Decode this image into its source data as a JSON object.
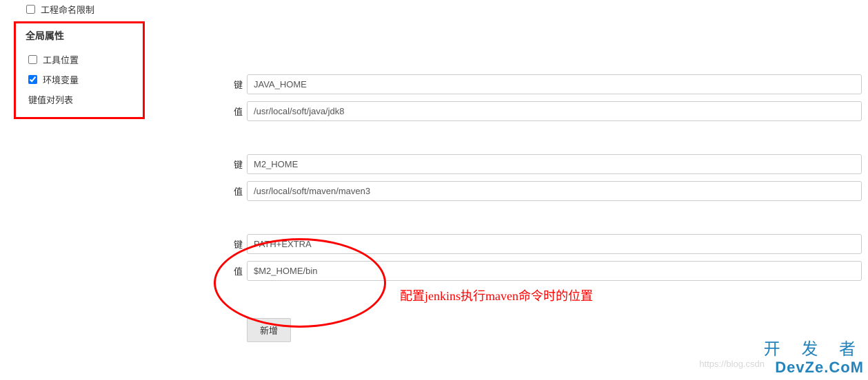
{
  "sidebar": {
    "top_item": "工程命名限制",
    "section_title": "全局属性",
    "items": [
      {
        "label": "工具位置",
        "checked": false
      },
      {
        "label": "环境变量",
        "checked": true
      }
    ],
    "sub_label": "键值对列表"
  },
  "env_vars": [
    {
      "key_label": "键",
      "key": "JAVA_HOME",
      "value_label": "值",
      "value": "/usr/local/soft/java/jdk8"
    },
    {
      "key_label": "键",
      "key": "M2_HOME",
      "value_label": "值",
      "value": "/usr/local/soft/maven/maven3"
    },
    {
      "key_label": "键",
      "key": "PATH+EXTRA",
      "value_label": "值",
      "value": "$M2_HOME/bin"
    }
  ],
  "buttons": {
    "add": "新增"
  },
  "annotation": "配置jenkins执行maven命令时的位置",
  "watermark": {
    "line1": "开 发 者",
    "line2": "DevZe.CoM",
    "url": "https://blog.csdn"
  }
}
